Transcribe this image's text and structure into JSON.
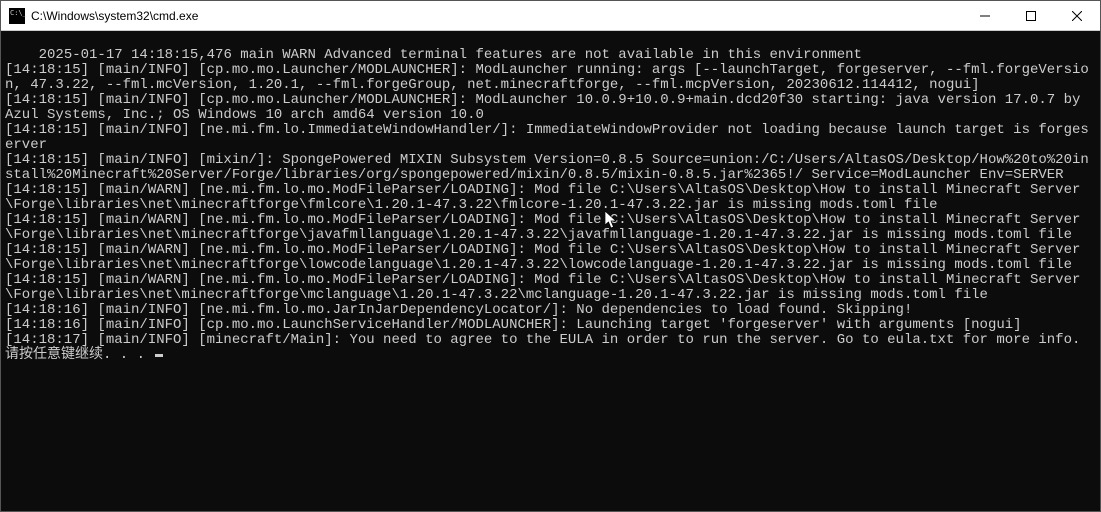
{
  "window": {
    "title": "C:\\Windows\\system32\\cmd.exe"
  },
  "console": {
    "lines": [
      "2025-01-17 14:18:15,476 main WARN Advanced terminal features are not available in this environment",
      "[14:18:15] [main/INFO] [cp.mo.mo.Launcher/MODLAUNCHER]: ModLauncher running: args [--launchTarget, forgeserver, --fml.forgeVersion, 47.3.22, --fml.mcVersion, 1.20.1, --fml.forgeGroup, net.minecraftforge, --fml.mcpVersion, 20230612.114412, nogui]",
      "[14:18:15] [main/INFO] [cp.mo.mo.Launcher/MODLAUNCHER]: ModLauncher 10.0.9+10.0.9+main.dcd20f30 starting: java version 17.0.7 by Azul Systems, Inc.; OS Windows 10 arch amd64 version 10.0",
      "[14:18:15] [main/INFO] [ne.mi.fm.lo.ImmediateWindowHandler/]: ImmediateWindowProvider not loading because launch target is forgeserver",
      "[14:18:15] [main/INFO] [mixin/]: SpongePowered MIXIN Subsystem Version=0.8.5 Source=union:/C:/Users/AltasOS/Desktop/How%20to%20install%20Minecraft%20Server/Forge/libraries/org/spongepowered/mixin/0.8.5/mixin-0.8.5.jar%2365!/ Service=ModLauncher Env=SERVER",
      "[14:18:15] [main/WARN] [ne.mi.fm.lo.mo.ModFileParser/LOADING]: Mod file C:\\Users\\AltasOS\\Desktop\\How to install Minecraft Server\\Forge\\libraries\\net\\minecraftforge\\fmlcore\\1.20.1-47.3.22\\fmlcore-1.20.1-47.3.22.jar is missing mods.toml file",
      "[14:18:15] [main/WARN] [ne.mi.fm.lo.mo.ModFileParser/LOADING]: Mod file C:\\Users\\AltasOS\\Desktop\\How to install Minecraft Server\\Forge\\libraries\\net\\minecraftforge\\javafmllanguage\\1.20.1-47.3.22\\javafmllanguage-1.20.1-47.3.22.jar is missing mods.toml file",
      "[14:18:15] [main/WARN] [ne.mi.fm.lo.mo.ModFileParser/LOADING]: Mod file C:\\Users\\AltasOS\\Desktop\\How to install Minecraft Server\\Forge\\libraries\\net\\minecraftforge\\lowcodelanguage\\1.20.1-47.3.22\\lowcodelanguage-1.20.1-47.3.22.jar is missing mods.toml file",
      "[14:18:15] [main/WARN] [ne.mi.fm.lo.mo.ModFileParser/LOADING]: Mod file C:\\Users\\AltasOS\\Desktop\\How to install Minecraft Server\\Forge\\libraries\\net\\minecraftforge\\mclanguage\\1.20.1-47.3.22\\mclanguage-1.20.1-47.3.22.jar is missing mods.toml file",
      "[14:18:16] [main/INFO] [ne.mi.fm.lo.mo.JarInJarDependencyLocator/]: No dependencies to load found. Skipping!",
      "[14:18:16] [main/INFO] [cp.mo.mo.LaunchServiceHandler/MODLAUNCHER]: Launching target 'forgeserver' with arguments [nogui]",
      "[14:18:17] [main/INFO] [minecraft/Main]: You need to agree to the EULA in order to run the server. Go to eula.txt for more info.",
      "请按任意键继续. . . "
    ]
  }
}
